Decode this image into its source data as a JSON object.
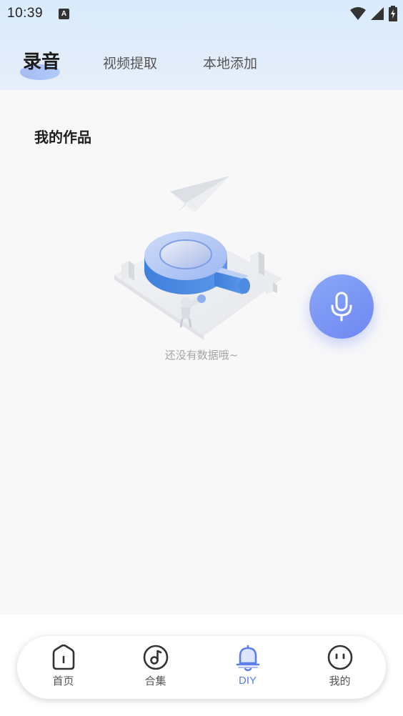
{
  "status": {
    "time": "10:39",
    "notification_glyph": "A"
  },
  "tabs": [
    {
      "label": "录音",
      "active": true
    },
    {
      "label": "视频提取",
      "active": false
    },
    {
      "label": "本地添加",
      "active": false
    }
  ],
  "main": {
    "section_title": "我的作品",
    "empty_text": "还没有数据哦~"
  },
  "nav": [
    {
      "label": "首页",
      "icon": "home-icon",
      "active": false
    },
    {
      "label": "合集",
      "icon": "music-note-icon",
      "active": false
    },
    {
      "label": "DIY",
      "icon": "bell-icon",
      "active": true
    },
    {
      "label": "我的",
      "icon": "face-icon",
      "active": false
    }
  ],
  "colors": {
    "accent": "#5c7ef0",
    "fab_gradient_start": "#8aa8f7",
    "fab_gradient_end": "#6e86f2",
    "header_bg": "#dcebfb",
    "body_bg": "#f8f8f9"
  }
}
